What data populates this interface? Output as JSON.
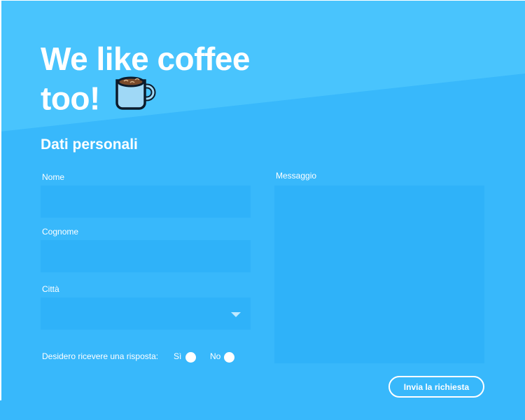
{
  "hero": {
    "title_line1": "We like coffee",
    "title_line2": "too!",
    "icon": "coffee-mug-icon"
  },
  "form": {
    "section_title": "Dati personali",
    "fields": {
      "nome": {
        "label": "Nome",
        "value": ""
      },
      "cognome": {
        "label": "Cognome",
        "value": ""
      },
      "citta": {
        "label": "Città",
        "selected": ""
      },
      "messaggio": {
        "label": "Messaggio",
        "value": ""
      }
    },
    "reply": {
      "question": "Desidero ricevere una risposta:",
      "option_yes": "Sì",
      "option_no": "No"
    },
    "submit_label": "Invia la richiesta"
  },
  "colors": {
    "background": "#38b8fb",
    "background_top": "#49c4fd",
    "field": "#2fb2f9",
    "text": "#ffffff"
  }
}
